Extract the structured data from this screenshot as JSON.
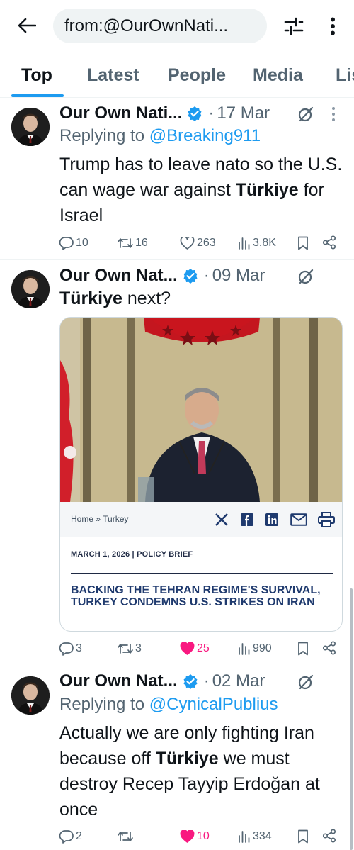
{
  "search": {
    "query": "from:@OurOwnNati..."
  },
  "tabs": [
    {
      "label": "Top"
    },
    {
      "label": "Latest"
    },
    {
      "label": "People"
    },
    {
      "label": "Media"
    },
    {
      "label": "Lis"
    }
  ],
  "tweets": [
    {
      "author": "Our Own Nati...",
      "date": "17 Mar",
      "reply_prefix": "Replying to",
      "reply_handle": "@Breaking911",
      "text_1": "Trump has to leave nato so the U.S. can wage war against ",
      "text_bold": "Türkiye",
      "text_2": " for Israel",
      "replies": "10",
      "reposts": "16",
      "likes": "263",
      "views": "3.8K"
    },
    {
      "author": "Our Own Nat...",
      "date": "09 Mar",
      "text_bold": "Türkiye",
      "text_2": " next?",
      "card": {
        "breadcrumb": "Home » Turkey",
        "meta": "MARCH 1, 2026 | POLICY BRIEF",
        "title": "BACKING THE TEHRAN REGIME'S SURVIVAL, TURKEY CONDEMNS U.S. STRIKES ON IRAN"
      },
      "replies": "3",
      "reposts": "3",
      "likes": "25",
      "views": "990"
    },
    {
      "author": "Our Own Nat...",
      "date": "02 Mar",
      "reply_prefix": "Replying to",
      "reply_handle": "@CynicalPublius",
      "text_1": "Actually we are only fighting Iran because off ",
      "text_bold": "Türkiye",
      "text_2": " we must destroy Recep Tayyip Erdoğan at once",
      "replies": "2",
      "likes": "10",
      "views": "334"
    }
  ],
  "colors": {
    "accent": "#1d9bf0",
    "like": "#f91880",
    "muted": "#536471"
  }
}
